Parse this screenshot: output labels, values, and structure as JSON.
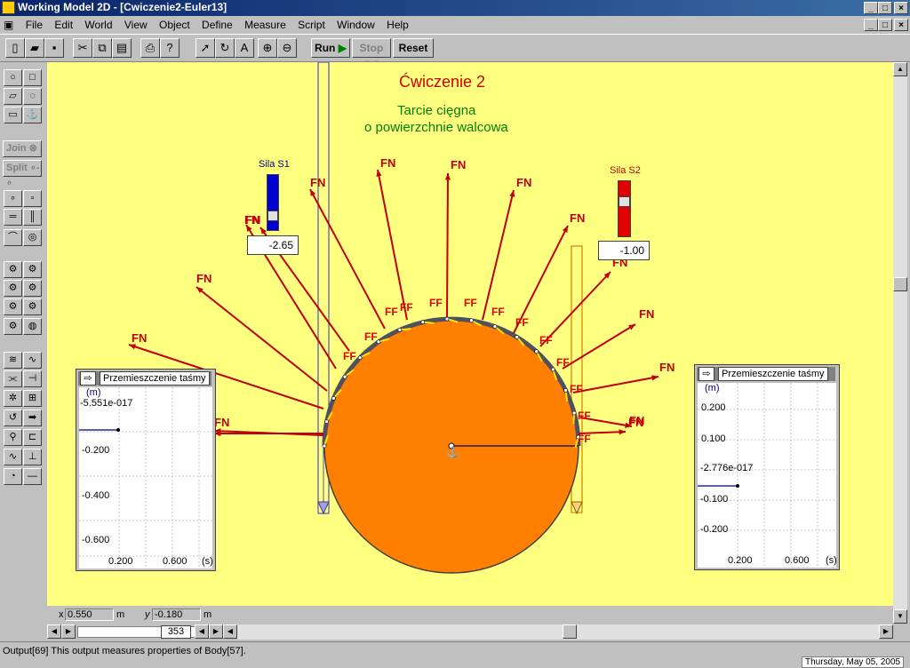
{
  "window": {
    "title": "Working Model 2D - [Cwiczenie2-Euler13]"
  },
  "menu": [
    "File",
    "Edit",
    "World",
    "View",
    "Object",
    "Define",
    "Measure",
    "Script",
    "Window",
    "Help"
  ],
  "toolbar": {
    "run_label": "Run",
    "stop_label": "Stop",
    "reset_label": "Reset"
  },
  "palette": {
    "join_label": "Join",
    "split_label": "Split"
  },
  "canvas": {
    "heading": "Ćwiczenie 2",
    "subtitle_line1": "Tarcie cięgna",
    "subtitle_line2": "o powierzchnie walcowa",
    "force_normal_label": "FN",
    "force_friction_label": "FF",
    "colors": {
      "background": "#ffff80",
      "cylinder": "#ff8000",
      "force": "#c00000",
      "heading": "#d00000",
      "subtitle": "#008000"
    }
  },
  "slider_s1": {
    "label": "Sila S1",
    "value": "-2.65",
    "color": "#0000d0"
  },
  "slider_s2": {
    "label": "Sila S2",
    "value": "-1.00",
    "color": "#e00000"
  },
  "meter_left": {
    "title": "Przemieszczenie taśmy",
    "unit": "(m)",
    "current_value": "-5.551e-017",
    "y_ticks": [
      "-0.200",
      "-0.400",
      "-0.600"
    ],
    "x_ticks": [
      "0.200",
      "0.600"
    ],
    "x_unit": "(s)"
  },
  "meter_right": {
    "title": "Przemieszczenie taśmy",
    "unit": "(m)",
    "current_value": "-2.776e-017",
    "y_ticks": [
      "0.200",
      "0.100",
      "-0.100",
      "-0.200"
    ],
    "x_ticks": [
      "0.200",
      "0.600"
    ],
    "x_unit": "(s)"
  },
  "coords": {
    "x_label": "x",
    "x_value": "0.550",
    "x_unit": "m",
    "y_label": "y",
    "y_value": "-0.180",
    "y_unit": "m"
  },
  "frame_counter": "353",
  "status": {
    "text": "Output[69]   This output measures properties of Body[57].",
    "clock": "Thursday, May 05, 2005"
  }
}
